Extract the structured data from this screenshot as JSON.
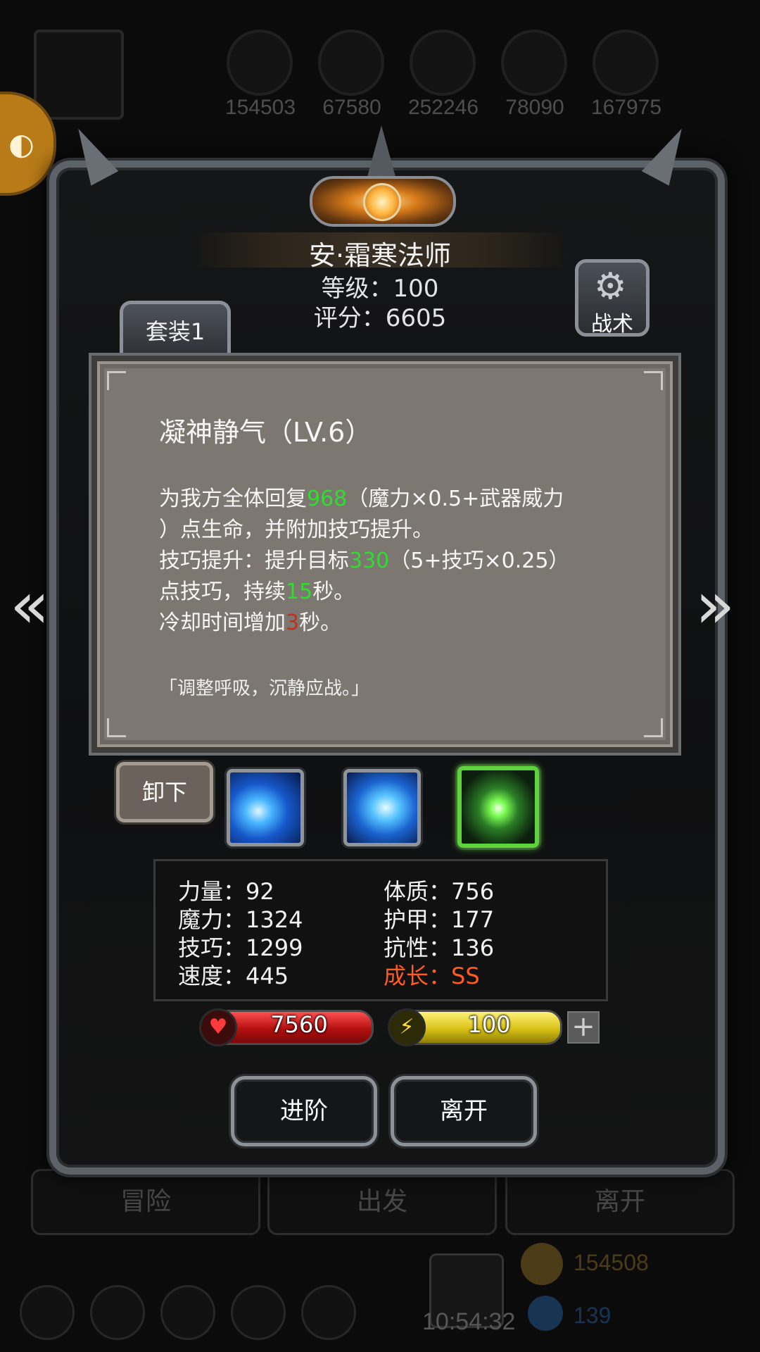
{
  "background": {
    "resources": [
      "154503",
      "67580",
      "252246",
      "78090",
      "167975"
    ],
    "tabs": [
      "冒险",
      "出发",
      "离开"
    ],
    "gold": "154508",
    "gems": "139",
    "clock": "10:54:32"
  },
  "hero": {
    "name": "安·霜寒法师",
    "level": "等级：100",
    "score": "评分：6605"
  },
  "set_tab": "套装1",
  "tactics_label": "战术",
  "skill": {
    "title": "凝神静气（LV.6）",
    "line1_pre": "为我方全体回复",
    "line1_num": "968",
    "line1_post": "（魔力×0.5+武器威力",
    "line2": "）点生命，并附加技巧提升。",
    "line3_pre": "技巧提升：提升目标",
    "line3_num": "330",
    "line3_post": "（5+技巧×0.25）",
    "line4_pre": "点技巧，持续",
    "line4_num": "15",
    "line4_post": "秒。",
    "line5_pre": "冷却时间增加",
    "line5_num": "3",
    "line5_post": "秒。",
    "quote": "「调整呼吸，沉静应战。」"
  },
  "unequip_label": "卸下",
  "stats": {
    "strength": "力量：92",
    "magic": "魔力：1324",
    "skill": "技巧：1299",
    "speed": "速度：445",
    "constitution": "体质：756",
    "armor": "护甲：177",
    "resistance": "抗性：136",
    "growth": "成长：SS"
  },
  "hp_value": "7560",
  "energy_value": "100",
  "plus_label": "+",
  "buttons": {
    "advance": "进阶",
    "leave": "离开"
  },
  "nav": {
    "prev": "«",
    "next": "»"
  },
  "colors": {
    "highlight_green": "#2fdc2f",
    "highlight_red": "#c0301c",
    "growth_orange": "#ff5a1f"
  }
}
